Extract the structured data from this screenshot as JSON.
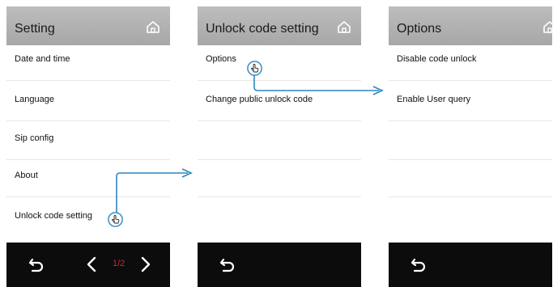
{
  "panels": [
    {
      "title": "Setting",
      "items": [
        "Date and time",
        "Language",
        "Sip config",
        "About",
        "Unlock code setting"
      ],
      "pager": "1/2"
    },
    {
      "title": "Unlock code setting",
      "items": [
        "Options",
        "Change public unlock code"
      ]
    },
    {
      "title": "Options",
      "items": [
        "Disable code unlock",
        "Enable User query"
      ]
    }
  ],
  "icons": {
    "home": "home-icon",
    "back": "back-arrow-icon",
    "prev": "chevron-left-icon",
    "next": "chevron-right-icon",
    "tap": "hand-pointer-icon"
  },
  "colors": {
    "header": "#b3b3b3",
    "footer": "#0c0c0c",
    "arrow": "#2e86c1",
    "pager": "#e02020"
  }
}
